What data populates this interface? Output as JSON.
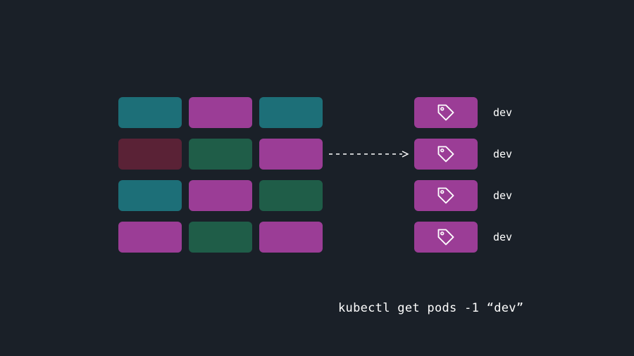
{
  "palette": {
    "bg": "#1a2028",
    "teal": "#1d6f78",
    "magenta": "#9b3d96",
    "green": "#1f5d48",
    "maroon": "#5a2236",
    "tagFill": "#9b3d96",
    "white": "#ffffff"
  },
  "grid": {
    "rows": 4,
    "cols": 3,
    "cells": [
      [
        "teal",
        "magenta",
        "teal"
      ],
      [
        "maroon",
        "green",
        "magenta"
      ],
      [
        "teal",
        "magenta",
        "green"
      ],
      [
        "magenta",
        "green",
        "magenta"
      ]
    ]
  },
  "arrow": {
    "style": "dashed",
    "direction": "right"
  },
  "results": [
    {
      "label": "dev"
    },
    {
      "label": "dev"
    },
    {
      "label": "dev"
    },
    {
      "label": "dev"
    }
  ],
  "tag_icon_name": "tag-icon",
  "command": "kubectl get pods -1 “dev”"
}
